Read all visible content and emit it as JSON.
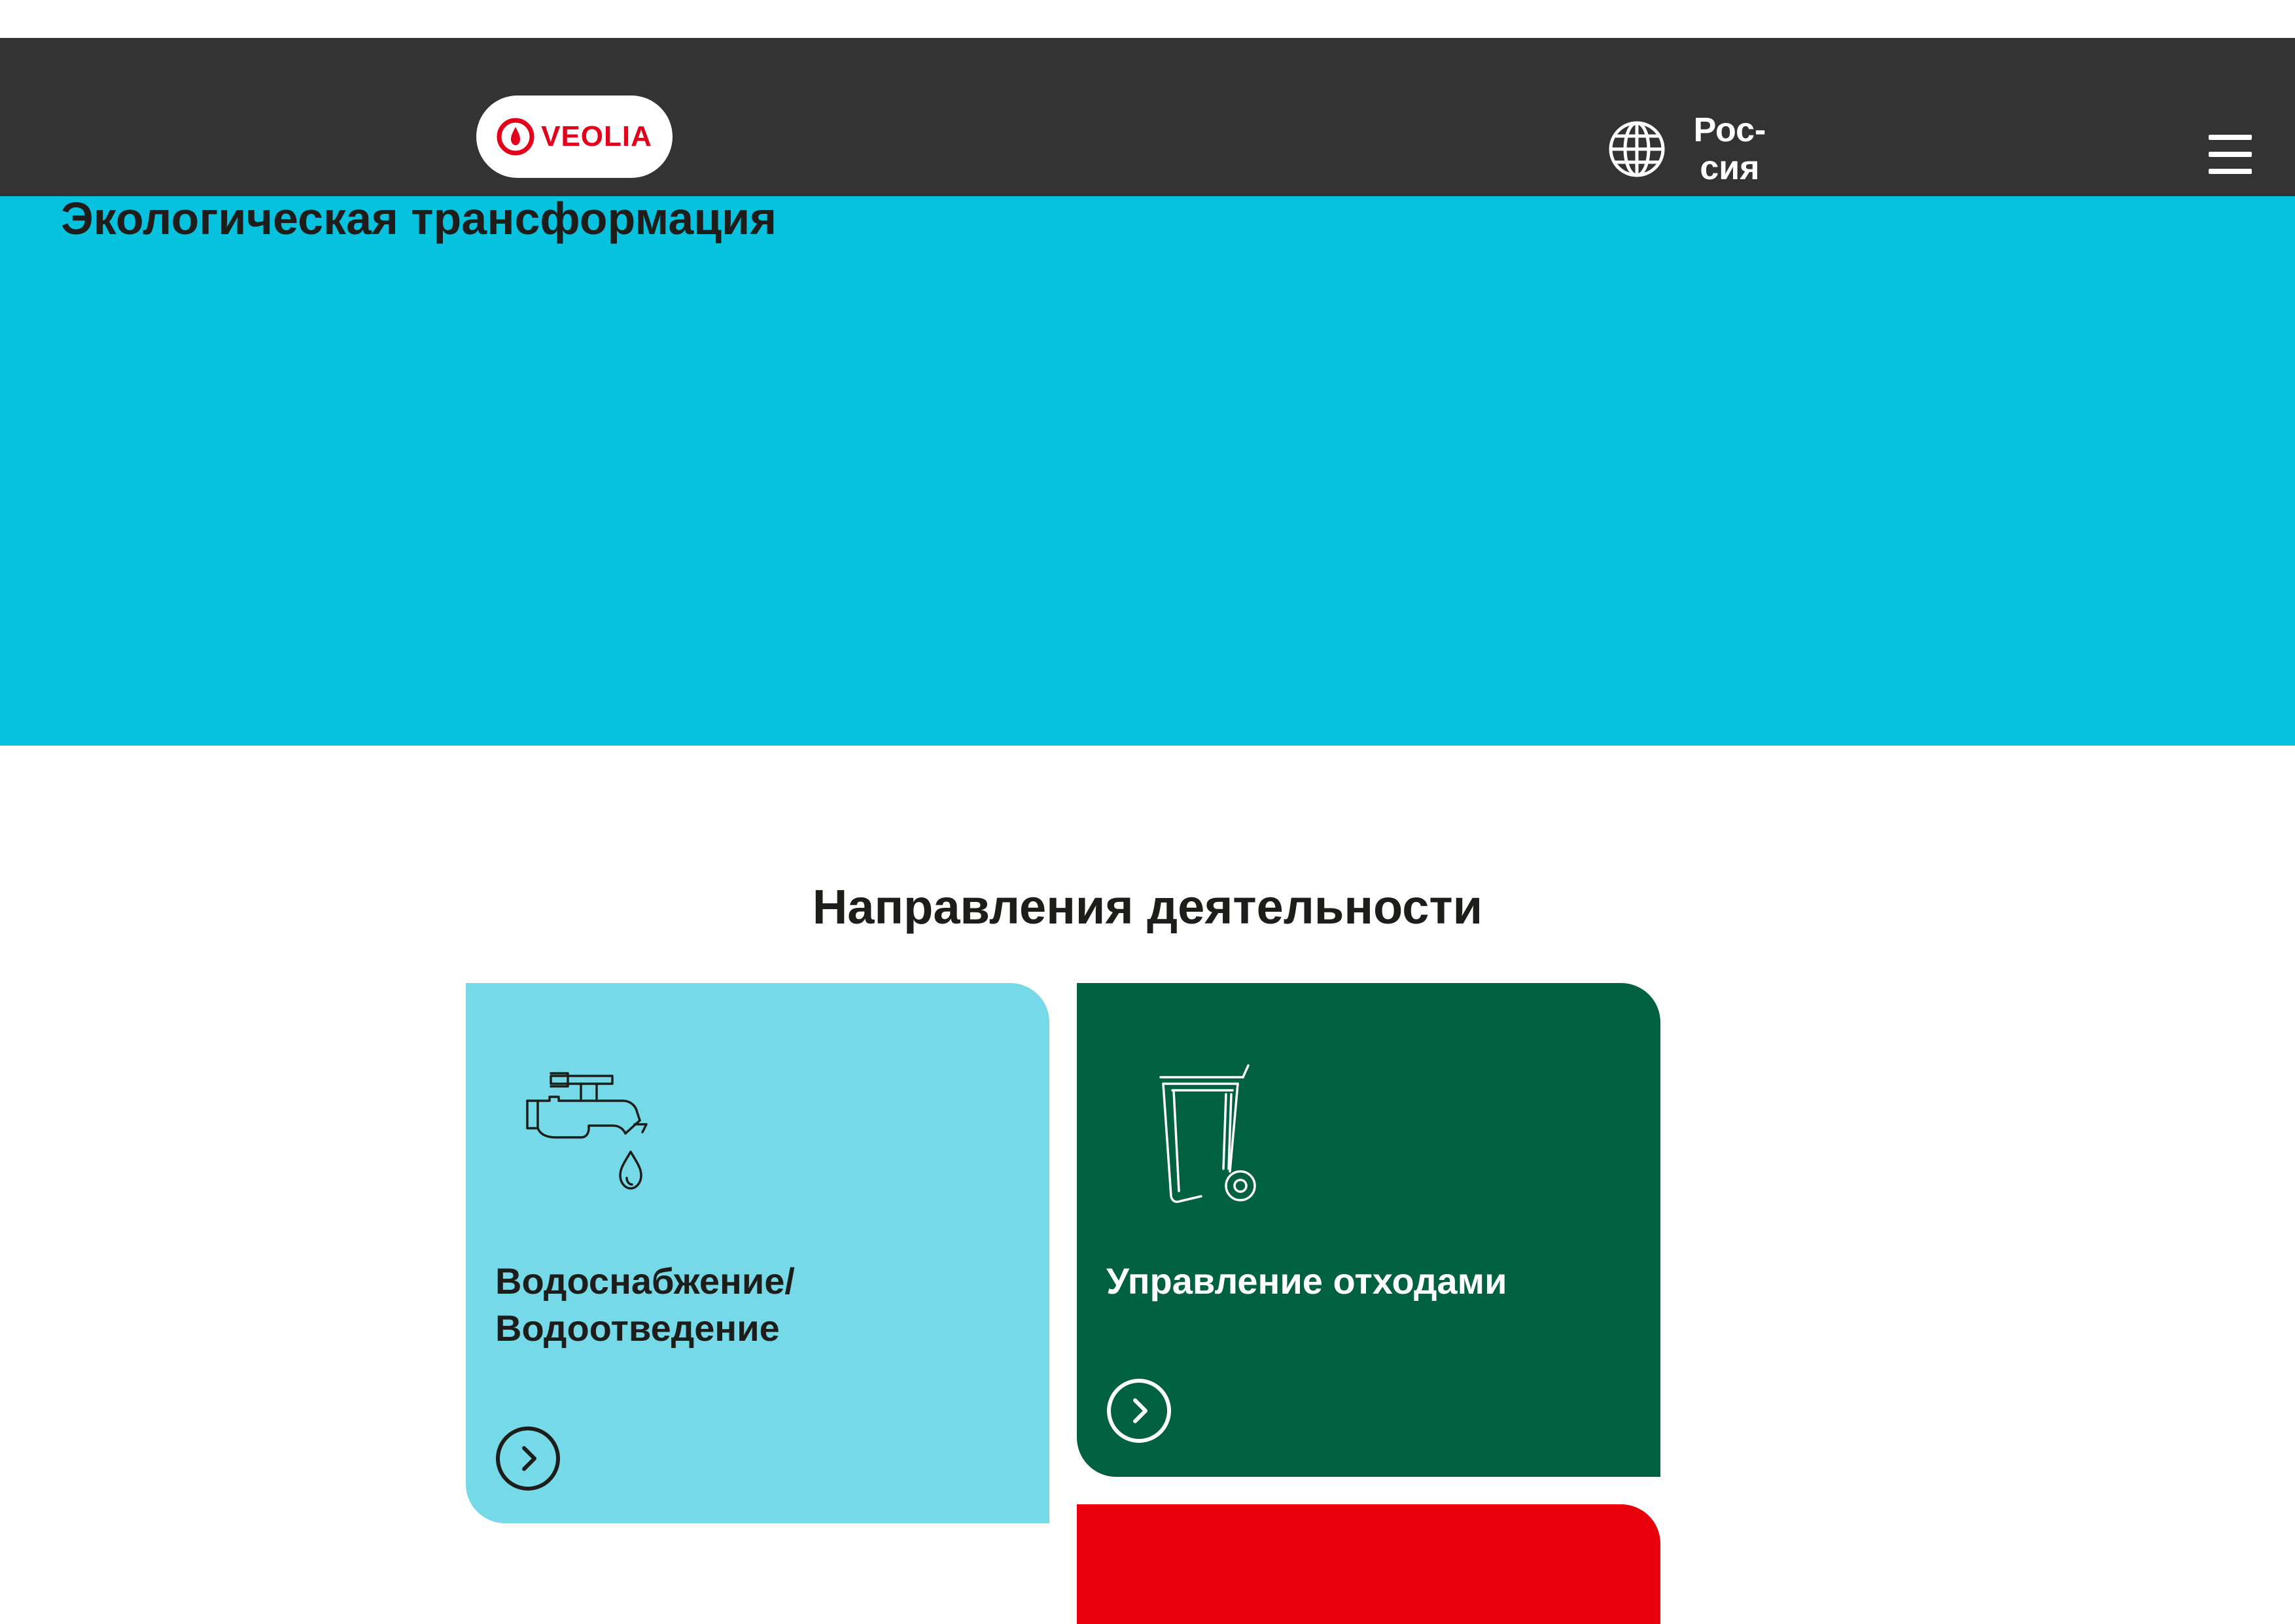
{
  "header": {
    "logo_text": "VEOLIA",
    "region_label": "Рос-\nсия",
    "menu_icon": "hamburger-menu-icon",
    "globe_icon": "globe-icon"
  },
  "hero": {
    "title": "Экологическая трансформация",
    "background_color": "#06c2de"
  },
  "activities": {
    "title": "Направления деятельности",
    "cards": [
      {
        "label": "Водоснабжение/\nВодоотведение",
        "icon": "water-tap-icon",
        "arrow_icon": "chevron-right-circle-icon",
        "color": "#76d9e8"
      },
      {
        "label": "Управление отходами",
        "icon": "wheelie-bin-icon",
        "arrow_icon": "chevron-right-circle-icon",
        "color": "#006140"
      },
      {
        "label": "",
        "color": "#e8000b"
      }
    ]
  },
  "colors": {
    "header_bg": "#333333",
    "brand_red": "#e3001b",
    "text_dark": "#1d1d1b"
  }
}
